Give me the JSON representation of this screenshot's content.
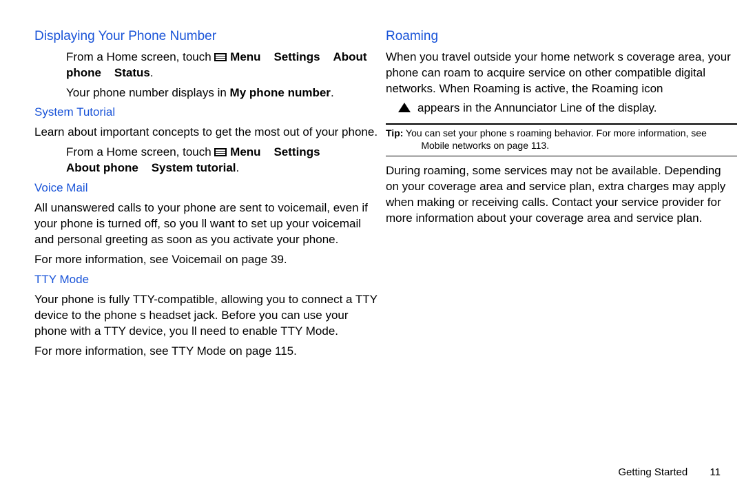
{
  "left": {
    "h1": "Displaying Your Phone Number",
    "p1a": "From a Home screen, touch",
    "p1b": "Menu",
    "p1arrow": " ",
    "p1c": "Settings",
    "p1d": "About",
    "p1e": "phone",
    "p1f": "Status",
    "p1g": ".",
    "p2a": "Your phone number displays in ",
    "p2b": "My phone number",
    "p2c": ".",
    "h2": "System Tutorial",
    "p3": "Learn about important concepts to get the most out of your phone.",
    "p4a": "From a Home screen, touch",
    "p4b": "Menu",
    "p4c": "Settings",
    "p4d": "About phone",
    "p4e": "System tutorial",
    "p4f": ".",
    "h3": "Voice Mail",
    "p5": "All unanswered calls to your phone are sent to voicemail, even if your phone is turned off, so you ll want to set up your voicemail and personal greeting as soon as you activate your phone.",
    "p6a": "For more information, see ",
    "p6b": "Voicemail",
    "p6c": " on page 39.",
    "h4": "TTY Mode",
    "p7": "Your phone is fully TTY-compatible, allowing you to connect a TTY device to the phone s headset jack. Before you can use your phone with a TTY device, you ll need to enable TTY Mode.",
    "p8a": "For more information, see ",
    "p8b": "TTY Mode",
    "p8c": " on page 115."
  },
  "right": {
    "h1": "Roaming",
    "p1": "When you travel outside your home network s coverage area, your phone can roam to acquire service on other compatible digital networks. When Roaming is active, the Roaming icon",
    "p1b": "appears in the Annunciator Line of the display.",
    "tipLabel": "Tip:",
    "tip1": "You can set your phone s roaming behavior. For more information, see",
    "tip2a": "Mobile networks",
    "tip2b": " on page 113.",
    "p2a": "During roaming, some services may not be available. Depending on your coverage area and service plan, extra charges may apply when making or receiving calls. ",
    "p2b": "Contact",
    "p2c": " your service provider for more information about your coverage area and service plan."
  },
  "footer": {
    "section": "Getting Started",
    "page": "11"
  }
}
